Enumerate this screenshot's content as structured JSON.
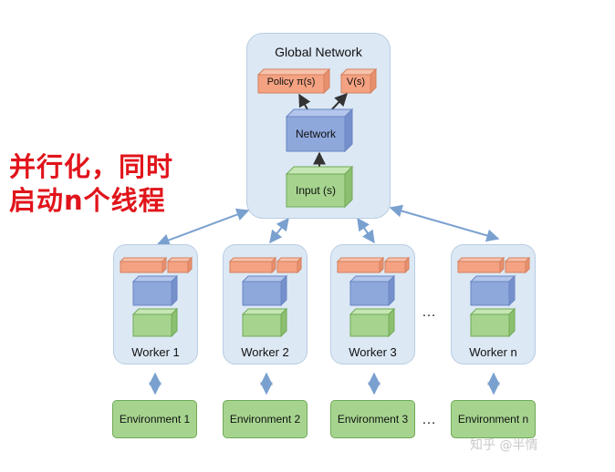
{
  "global": {
    "title": "Global Network",
    "policy_label": "Policy π(s)",
    "value_label": "V(s)",
    "network_label": "Network",
    "input_label": "Input (s)"
  },
  "annotation": {
    "line1": "并行化，同时",
    "line2": "启动n个线程"
  },
  "workers": [
    {
      "label": "Worker 1",
      "env": "Environment 1"
    },
    {
      "label": "Worker 2",
      "env": "Environment 2"
    },
    {
      "label": "Worker 3",
      "env": "Environment 3"
    },
    {
      "label": "Worker n",
      "env": "Environment n"
    }
  ],
  "ellipsis": "…",
  "watermark": "知乎 @半情",
  "colors": {
    "orange": "#f4a282",
    "blue": "#8ea8dc",
    "green": "#a6d48f",
    "arrow_blue": "#7aa0d0",
    "panel": "#dce8f4",
    "annotation": "#e1141b"
  }
}
